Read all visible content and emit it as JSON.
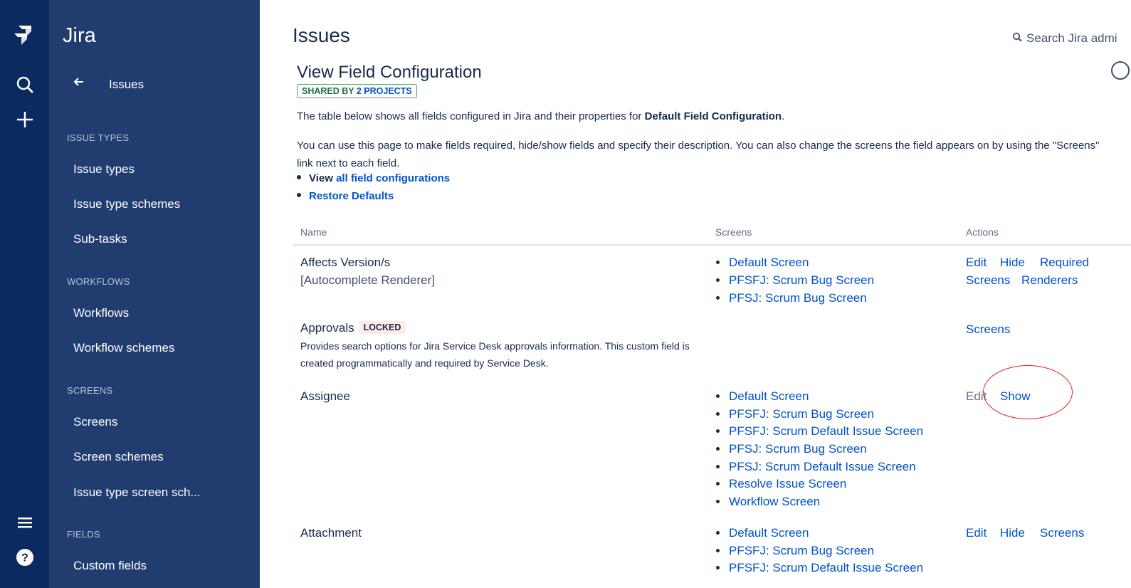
{
  "rail": {
    "icons": [
      "jira-logo-icon",
      "search-icon",
      "plus-icon",
      "menu-icon",
      "help-icon"
    ]
  },
  "sidebar": {
    "brand": "Jira",
    "back_label": "Issues",
    "sections": [
      {
        "title": "ISSUE TYPES",
        "items": [
          "Issue types",
          "Issue type schemes",
          "Sub-tasks"
        ]
      },
      {
        "title": "WORKFLOWS",
        "items": [
          "Workflows",
          "Workflow schemes"
        ]
      },
      {
        "title": "SCREENS",
        "items": [
          "Screens",
          "Screen schemes",
          "Issue type screen sch..."
        ]
      },
      {
        "title": "FIELDS",
        "items": [
          "Custom fields"
        ]
      }
    ]
  },
  "header": {
    "title": "Issues",
    "search_label": "Search Jira admi"
  },
  "main": {
    "heading": "View Field Configuration",
    "shared_prefix": "SHARED BY ",
    "shared_link": "2 PROJECTS",
    "intro_prefix": "The table below shows all fields configured in Jira and their properties for ",
    "intro_bold": "Default Field Configuration",
    "intro_suffix": ".",
    "description": "You can use this page to make fields required, hide/show fields and specify their description. You can also change the screens the field appears on by using the \"Screens\" link next to each field.",
    "links": {
      "view_prefix": "View ",
      "view_link": "all field configurations",
      "restore": "Restore Defaults"
    }
  },
  "table": {
    "columns": [
      "Name",
      "Screens",
      "Actions"
    ],
    "rows": [
      {
        "name": "Affects Version/s",
        "renderer": "[Autocomplete Renderer]",
        "screens": [
          "Default Screen",
          "PFSFJ: Scrum Bug Screen",
          "PFSJ: Scrum Bug Screen"
        ],
        "actions": [
          "Edit",
          "Hide",
          "Required",
          "Screens",
          "Renderers"
        ]
      },
      {
        "name": "Approvals",
        "badge": "LOCKED",
        "description": "Provides search options for Jira Service Desk approvals information. This custom field is created programmatically and required by Service Desk.",
        "screens": [],
        "actions": [
          "Screens"
        ]
      },
      {
        "name": "Assignee",
        "screens": [
          "Default Screen",
          "PFSFJ: Scrum Bug Screen",
          "PFSFJ: Scrum Default Issue Screen",
          "PFSJ: Scrum Bug Screen",
          "PFSJ: Scrum Default Issue Screen",
          "Resolve Issue Screen",
          "Workflow Screen"
        ],
        "actions": [
          "Edit",
          "Show"
        ]
      },
      {
        "name": "Attachment",
        "screens": [
          "Default Screen",
          "PFSFJ: Scrum Bug Screen",
          "PFSFJ: Scrum Default Issue Screen"
        ],
        "actions": [
          "Edit",
          "Hide",
          "Screens"
        ]
      }
    ]
  },
  "colors": {
    "rail": "#0b2a60",
    "sidebar": "#213d70",
    "link": "#0052cc",
    "annotation_circle": "#e32020"
  }
}
